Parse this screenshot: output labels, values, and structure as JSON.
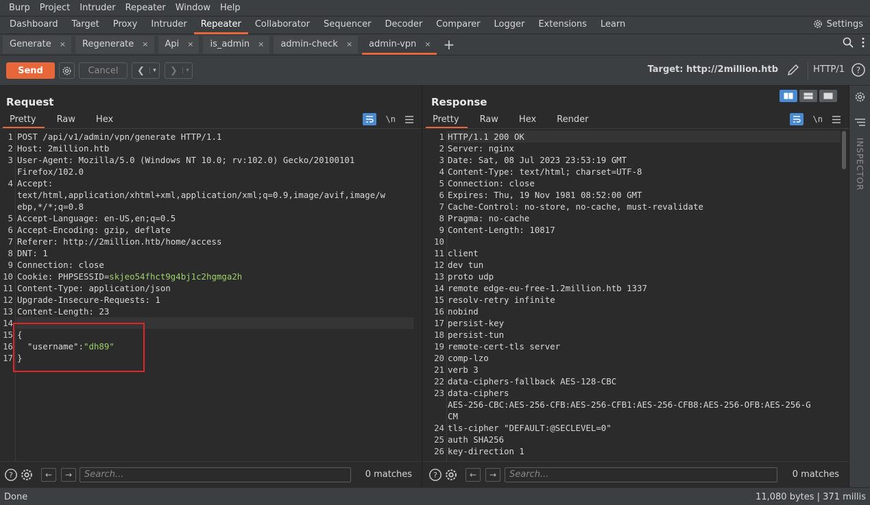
{
  "menu": [
    "Burp",
    "Project",
    "Intruder",
    "Repeater",
    "Window",
    "Help"
  ],
  "top_tabs": [
    "Dashboard",
    "Target",
    "Proxy",
    "Intruder",
    "Repeater",
    "Collaborator",
    "Sequencer",
    "Decoder",
    "Comparer",
    "Logger",
    "Extensions",
    "Learn"
  ],
  "top_tabs_active": "Repeater",
  "settings_label": "Settings",
  "repeater_tabs": [
    "Generate",
    "Regenerate",
    "Api",
    "is_admin",
    "admin-check",
    "admin-vpn"
  ],
  "repeater_tab_active": "admin-vpn",
  "toolbar": {
    "send": "Send",
    "cancel": "Cancel",
    "target": "Target: http://2million.htb",
    "http_version": "HTTP/1"
  },
  "request": {
    "title": "Request",
    "tabs": [
      "Pretty",
      "Raw",
      "Hex"
    ],
    "lines": [
      {
        "n": "1",
        "k": "POST /api/v1/admin/vpn/generate HTTP/1.1",
        "v": ""
      },
      {
        "n": "2",
        "k": "Host:",
        "v": " 2million.htb"
      },
      {
        "n": "3",
        "k": "User-Agent:",
        "v": " Mozilla/5.0 (Windows NT 10.0; rv:102.0) Gecko/20100101"
      },
      {
        "n": "",
        "k": "",
        "v": "Firefox/102.0"
      },
      {
        "n": "4",
        "k": "Accept:",
        "v": ""
      },
      {
        "n": "",
        "k": "",
        "v": "text/html,application/xhtml+xml,application/xml;q=0.9,image/avif,image/w"
      },
      {
        "n": "",
        "k": "",
        "v": "ebp,*/*;q=0.8"
      },
      {
        "n": "5",
        "k": "Accept-Language:",
        "v": " en-US,en;q=0.5"
      },
      {
        "n": "6",
        "k": "Accept-Encoding:",
        "v": " gzip, deflate"
      },
      {
        "n": "7",
        "k": "Referer:",
        "v": " http://2million.htb/home/access"
      },
      {
        "n": "8",
        "k": "DNT:",
        "v": " 1"
      },
      {
        "n": "9",
        "k": "Connection:",
        "v": " close"
      },
      {
        "n": "10",
        "k": "Cookie:",
        "v": " PHPSESSID=",
        "c": "skjeo54fhct9g4bj1c2hgmga2h"
      },
      {
        "n": "11",
        "k": "Content-Type:",
        "v": " application/json"
      },
      {
        "n": "12",
        "k": "Upgrade-Insecure-Requests:",
        "v": " 1"
      },
      {
        "n": "13",
        "k": "Content-Length:",
        "v": " 23"
      },
      {
        "n": "14",
        "k": "",
        "v": ""
      },
      {
        "n": "15",
        "k": "{",
        "v": ""
      },
      {
        "n": "16",
        "k": "  \"username\":",
        "v": "",
        "c": "\"dh89\""
      },
      {
        "n": "17",
        "k": "}",
        "v": ""
      }
    ],
    "search_placeholder": "Search...",
    "matches": "0 matches"
  },
  "response": {
    "title": "Response",
    "tabs": [
      "Pretty",
      "Raw",
      "Hex",
      "Render"
    ],
    "lines": [
      {
        "n": "1",
        "k": "HTTP/1.1 200 OK",
        "v": ""
      },
      {
        "n": "2",
        "k": "Server:",
        "v": " nginx"
      },
      {
        "n": "3",
        "k": "Date:",
        "v": " Sat, 08 Jul 2023 23:53:19 GMT"
      },
      {
        "n": "4",
        "k": "Content-Type:",
        "v": " text/html; charset=UTF-8"
      },
      {
        "n": "5",
        "k": "Connection:",
        "v": " close"
      },
      {
        "n": "6",
        "k": "Expires:",
        "v": " Thu, 19 Nov 1981 08:52:00 GMT"
      },
      {
        "n": "7",
        "k": "Cache-Control:",
        "v": " no-store, no-cache, must-revalidate"
      },
      {
        "n": "8",
        "k": "Pragma:",
        "v": " no-cache"
      },
      {
        "n": "9",
        "k": "Content-Length:",
        "v": " 10817"
      },
      {
        "n": "10",
        "k": "",
        "v": ""
      },
      {
        "n": "11",
        "k": "client",
        "v": ""
      },
      {
        "n": "12",
        "k": "dev tun",
        "v": ""
      },
      {
        "n": "13",
        "k": "proto udp",
        "v": ""
      },
      {
        "n": "14",
        "k": "remote edge-eu-free-1.2million.htb 1337",
        "v": ""
      },
      {
        "n": "15",
        "k": "resolv-retry infinite",
        "v": ""
      },
      {
        "n": "16",
        "k": "nobind",
        "v": ""
      },
      {
        "n": "17",
        "k": "persist-key",
        "v": ""
      },
      {
        "n": "18",
        "k": "persist-tun",
        "v": ""
      },
      {
        "n": "19",
        "k": "remote-cert-tls server",
        "v": ""
      },
      {
        "n": "20",
        "k": "comp-lzo",
        "v": ""
      },
      {
        "n": "21",
        "k": "verb 3",
        "v": ""
      },
      {
        "n": "22",
        "k": "data-ciphers-fallback AES-128-CBC",
        "v": ""
      },
      {
        "n": "23",
        "k": "data-ciphers",
        "v": ""
      },
      {
        "n": "",
        "k": "AES-256-CBC:AES-256-CFB:AES-256-CFB1:AES-256-CFB8:AES-256-OFB:AES-256-G",
        "v": ""
      },
      {
        "n": "",
        "k": "CM",
        "v": ""
      },
      {
        "n": "24",
        "k": "tls-cipher \"DEFAULT:@SECLEVEL=0\"",
        "v": ""
      },
      {
        "n": "25",
        "k": "auth SHA256",
        "v": ""
      },
      {
        "n": "26",
        "k": "key-direction 1",
        "v": ""
      }
    ],
    "search_placeholder": "Search...",
    "matches": "0 matches"
  },
  "inspector_label": "INSPECTOR",
  "status": {
    "left": "Done",
    "right": "11,080 bytes | 371 millis"
  },
  "colors": {
    "accent": "#e8673a",
    "highlight_box": "#e0252b",
    "cookie_value": "#9bd16a"
  }
}
